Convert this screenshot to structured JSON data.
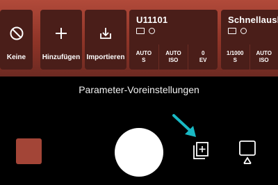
{
  "actions": [
    {
      "label": "Keine",
      "icon": "none-circle-icon"
    },
    {
      "label": "Hinzufügen",
      "icon": "plus-icon"
    },
    {
      "label": "Importieren",
      "icon": "import-icon"
    }
  ],
  "presets": [
    {
      "title": "U11101",
      "cells": [
        {
          "line1": "AUTO",
          "line2": "S"
        },
        {
          "line1": "AUTO",
          "line2": "ISO"
        },
        {
          "line1": "0",
          "line2": "EV"
        }
      ]
    },
    {
      "title": "Schnellauslö",
      "cells": [
        {
          "line1": "1/1000",
          "line2": "S"
        },
        {
          "line1": "AUTO",
          "line2": "ISO"
        }
      ]
    }
  ],
  "caption": "Parameter-Voreinstellungen",
  "colors": {
    "strip_top": "#b14a3a",
    "tile_bg": "#4a1e19",
    "thumbnail": "#a34537",
    "highlight_arrow": "#19b9c4"
  }
}
